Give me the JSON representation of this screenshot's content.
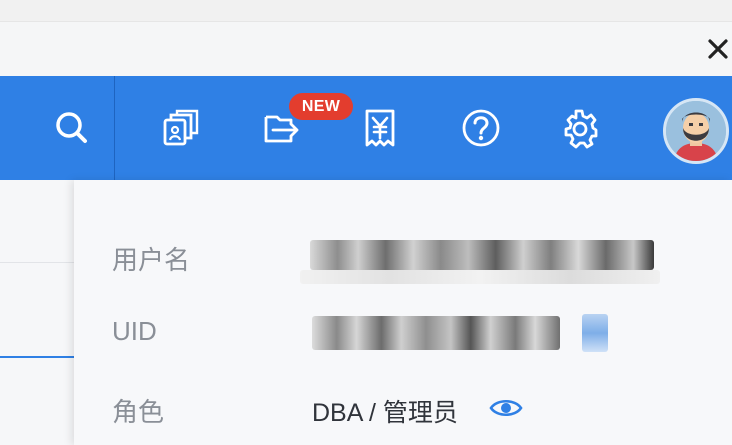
{
  "header": {
    "badge": "NEW",
    "icons": [
      "search-icon",
      "copy-document-icon",
      "export-icon",
      "yuan-receipt-icon",
      "help-icon",
      "settings-icon"
    ],
    "accent": "#2f80e5",
    "badge_color": "#e33d2e"
  },
  "profile": {
    "username_label": "用户名",
    "uid_label": "UID",
    "role_label": "角色",
    "role_value": "DBA / 管理员"
  }
}
